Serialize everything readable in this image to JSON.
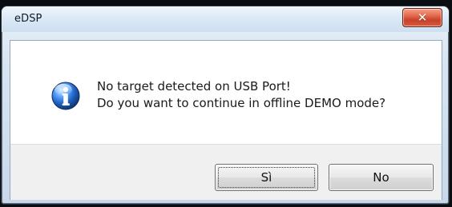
{
  "window": {
    "title": "eDSP",
    "close_icon": "close-icon",
    "close_symbol": "✕"
  },
  "dialog": {
    "icon": "info-icon",
    "message_line1": "No target detected on USB Port!",
    "message_line2": "Do you want to continue in offline DEMO mode?"
  },
  "buttons": {
    "yes_label": "Sì",
    "no_label": "No"
  },
  "colors": {
    "close_red": "#c7412a",
    "info_blue": "#1f5fbf"
  }
}
